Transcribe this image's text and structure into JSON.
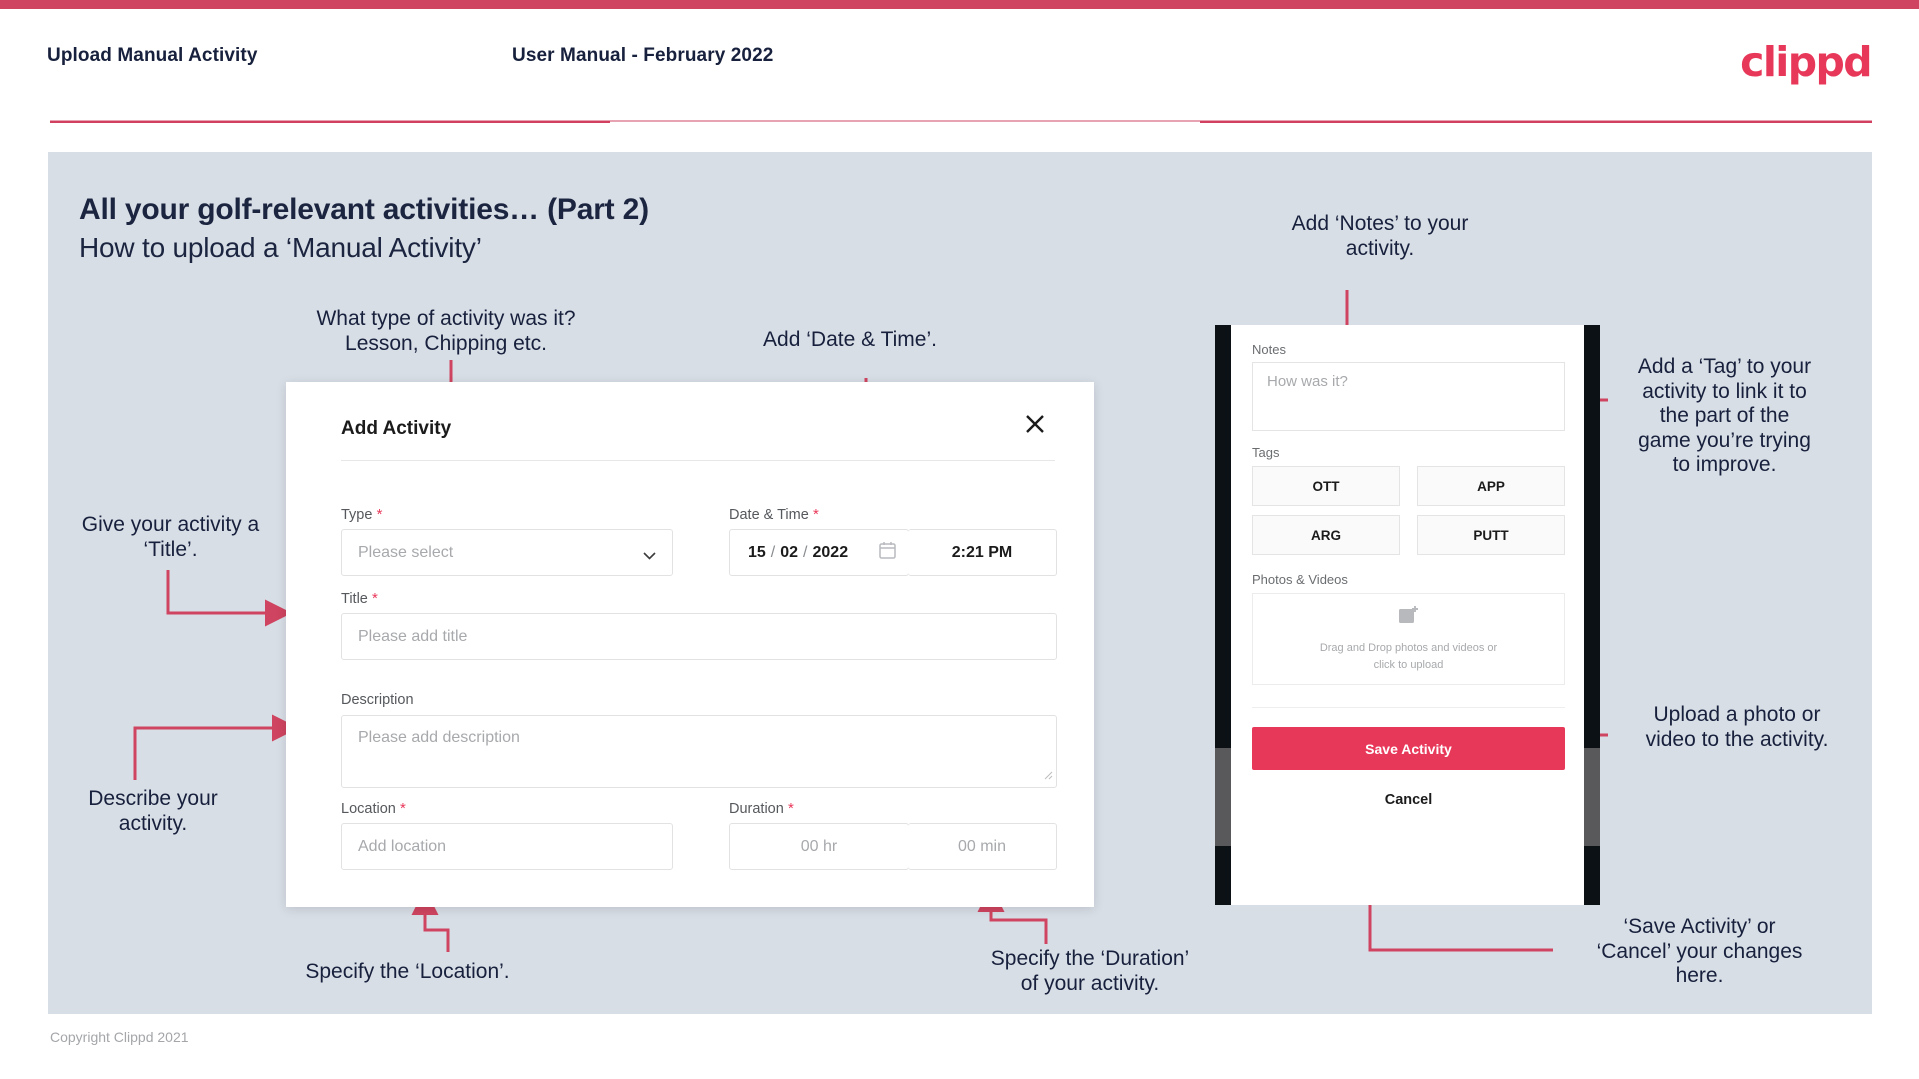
{
  "header": {
    "left_title": "Upload Manual Activity",
    "center_title": "User Manual - February 2022",
    "logo": "clippd"
  },
  "slide": {
    "title": "All your golf-relevant activities… (Part 2)",
    "subtitle": "How to upload a ‘Manual Activity’"
  },
  "annotations": {
    "type": "What type of activity was it?\nLesson, Chipping etc.",
    "datetime": "Add ‘Date & Time’.",
    "title_field": "Give your activity a\n‘Title’.",
    "description": "Describe your\nactivity.",
    "location": "Specify the ‘Location’.",
    "duration": "Specify the ‘Duration’\nof your activity.",
    "notes": "Add ‘Notes’ to your\nactivity.",
    "tags": "Add a ‘Tag’ to your\nactivity to link it to\nthe part of the\ngame you’re trying\nto improve.",
    "photos": "Upload a photo or\nvideo to the activity.",
    "save_cancel": "‘Save Activity’ or\n‘Cancel’ your changes\nhere."
  },
  "dialog": {
    "title": "Add Activity",
    "close_icon": "close-icon",
    "fields": {
      "type": {
        "label": "Type",
        "required": true,
        "placeholder": "Please select",
        "value": ""
      },
      "datetime": {
        "label": "Date & Time",
        "required": true,
        "day": "15",
        "sep1": "/",
        "month": "02",
        "sep2": "/",
        "year": "2022",
        "calendar_icon": "calendar-icon",
        "time": "2:21 PM"
      },
      "title": {
        "label": "Title",
        "required": true,
        "placeholder": "Please add title",
        "value": ""
      },
      "description": {
        "label": "Description",
        "required": false,
        "placeholder": "Please add description",
        "value": ""
      },
      "location": {
        "label": "Location",
        "required": true,
        "placeholder": "Add location",
        "value": ""
      },
      "duration": {
        "label": "Duration",
        "required": true,
        "hours_placeholder": "00 hr",
        "minutes_placeholder": "00 min"
      }
    }
  },
  "phone": {
    "notes": {
      "label": "Notes",
      "placeholder": "How was it?"
    },
    "tags": {
      "label": "Tags",
      "items": [
        "OTT",
        "APP",
        "ARG",
        "PUTT"
      ]
    },
    "photos": {
      "label": "Photos & Videos",
      "icon": "add-image-icon",
      "dropzone_line1": "Drag and Drop photos and videos or",
      "dropzone_line2": "click to upload"
    },
    "save_label": "Save Activity",
    "cancel_label": "Cancel"
  },
  "footer": {
    "copyright": "Copyright Clippd 2021"
  },
  "colors": {
    "brand": "#e8385a",
    "accent_bar": "#cf4460",
    "annotation_line": "#cf4460",
    "panel_bg": "#d8dee6",
    "text_dark": "#17203c"
  }
}
